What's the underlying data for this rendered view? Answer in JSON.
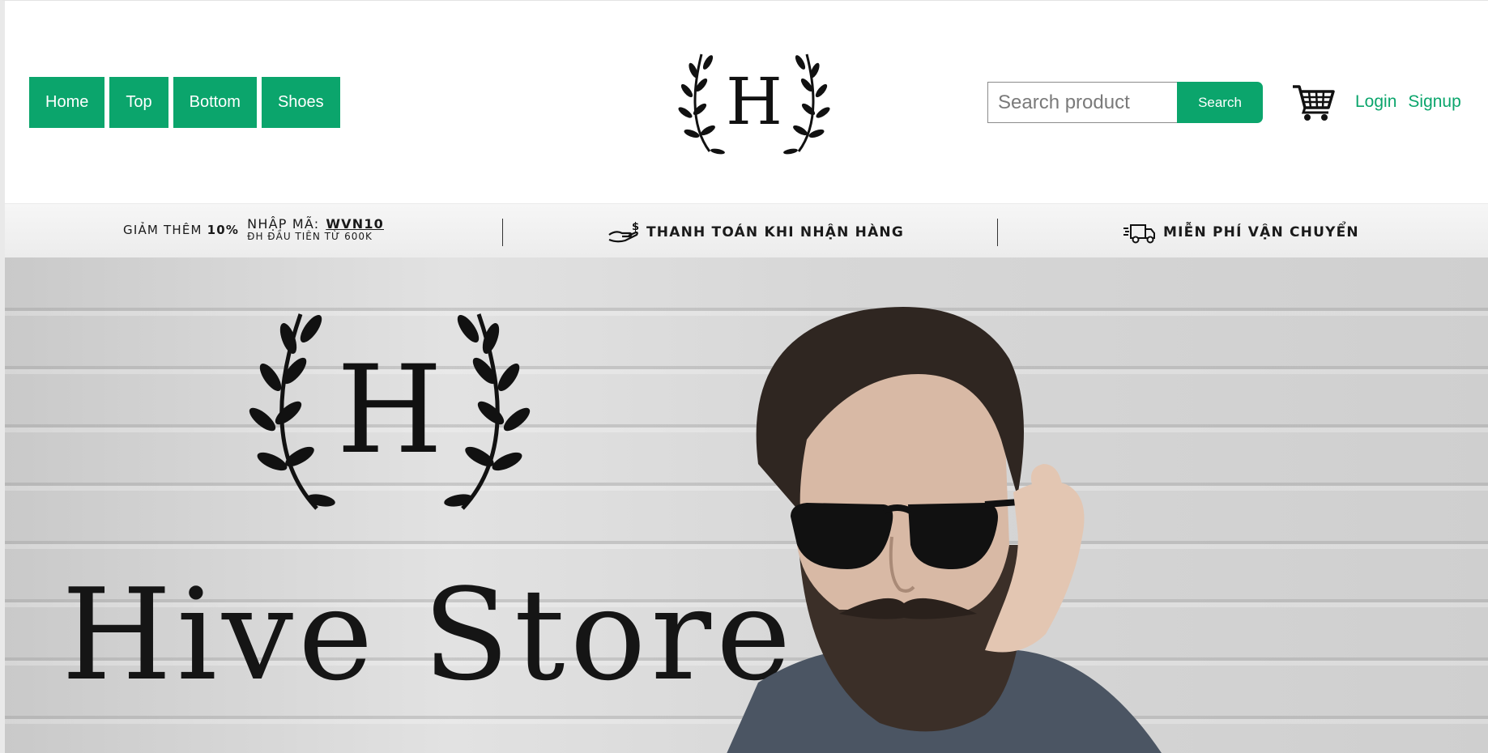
{
  "nav": {
    "items": [
      {
        "label": "Home"
      },
      {
        "label": "Top"
      },
      {
        "label": "Bottom"
      },
      {
        "label": "Shoes"
      }
    ]
  },
  "logo": {
    "letter": "H",
    "icon": "laurel-wreath-logo"
  },
  "search": {
    "placeholder": "Search product",
    "button_label": "Search"
  },
  "cart": {
    "icon": "cart-icon"
  },
  "auth": {
    "login_label": "Login",
    "signup_label": "Signup"
  },
  "promo": {
    "discount_lead": "GIẢM THÊM",
    "discount_value": "10%",
    "code_label": "NHẬP MÃ:",
    "code_value": "WVN10",
    "code_sub": "ĐH ĐẦU TIÊN TỪ 600K",
    "cod_text": "THANH TOÁN KHI NHẬN HÀNG",
    "cod_icon": "hand-money-icon",
    "shipping_text": "MIỄN PHÍ VẬN CHUYỂN",
    "shipping_icon": "delivery-truck-icon"
  },
  "hero": {
    "logo_letter": "H",
    "title": "Hive Store",
    "image": "bearded-man-sunglasses-photo"
  },
  "colors": {
    "accent": "#0ba56c",
    "text": "#1a1a1a"
  }
}
